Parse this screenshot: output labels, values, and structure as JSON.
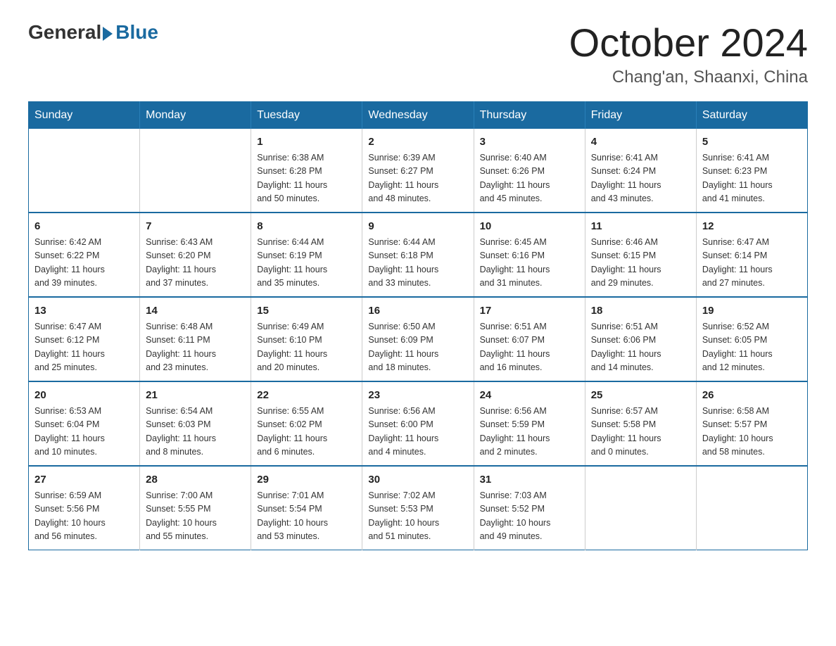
{
  "header": {
    "logo_general": "General",
    "logo_blue": "Blue",
    "title": "October 2024",
    "subtitle": "Chang'an, Shaanxi, China"
  },
  "calendar": {
    "days_of_week": [
      "Sunday",
      "Monday",
      "Tuesday",
      "Wednesday",
      "Thursday",
      "Friday",
      "Saturday"
    ],
    "weeks": [
      [
        {
          "day": "",
          "info": ""
        },
        {
          "day": "",
          "info": ""
        },
        {
          "day": "1",
          "info": "Sunrise: 6:38 AM\nSunset: 6:28 PM\nDaylight: 11 hours\nand 50 minutes."
        },
        {
          "day": "2",
          "info": "Sunrise: 6:39 AM\nSunset: 6:27 PM\nDaylight: 11 hours\nand 48 minutes."
        },
        {
          "day": "3",
          "info": "Sunrise: 6:40 AM\nSunset: 6:26 PM\nDaylight: 11 hours\nand 45 minutes."
        },
        {
          "day": "4",
          "info": "Sunrise: 6:41 AM\nSunset: 6:24 PM\nDaylight: 11 hours\nand 43 minutes."
        },
        {
          "day": "5",
          "info": "Sunrise: 6:41 AM\nSunset: 6:23 PM\nDaylight: 11 hours\nand 41 minutes."
        }
      ],
      [
        {
          "day": "6",
          "info": "Sunrise: 6:42 AM\nSunset: 6:22 PM\nDaylight: 11 hours\nand 39 minutes."
        },
        {
          "day": "7",
          "info": "Sunrise: 6:43 AM\nSunset: 6:20 PM\nDaylight: 11 hours\nand 37 minutes."
        },
        {
          "day": "8",
          "info": "Sunrise: 6:44 AM\nSunset: 6:19 PM\nDaylight: 11 hours\nand 35 minutes."
        },
        {
          "day": "9",
          "info": "Sunrise: 6:44 AM\nSunset: 6:18 PM\nDaylight: 11 hours\nand 33 minutes."
        },
        {
          "day": "10",
          "info": "Sunrise: 6:45 AM\nSunset: 6:16 PM\nDaylight: 11 hours\nand 31 minutes."
        },
        {
          "day": "11",
          "info": "Sunrise: 6:46 AM\nSunset: 6:15 PM\nDaylight: 11 hours\nand 29 minutes."
        },
        {
          "day": "12",
          "info": "Sunrise: 6:47 AM\nSunset: 6:14 PM\nDaylight: 11 hours\nand 27 minutes."
        }
      ],
      [
        {
          "day": "13",
          "info": "Sunrise: 6:47 AM\nSunset: 6:12 PM\nDaylight: 11 hours\nand 25 minutes."
        },
        {
          "day": "14",
          "info": "Sunrise: 6:48 AM\nSunset: 6:11 PM\nDaylight: 11 hours\nand 23 minutes."
        },
        {
          "day": "15",
          "info": "Sunrise: 6:49 AM\nSunset: 6:10 PM\nDaylight: 11 hours\nand 20 minutes."
        },
        {
          "day": "16",
          "info": "Sunrise: 6:50 AM\nSunset: 6:09 PM\nDaylight: 11 hours\nand 18 minutes."
        },
        {
          "day": "17",
          "info": "Sunrise: 6:51 AM\nSunset: 6:07 PM\nDaylight: 11 hours\nand 16 minutes."
        },
        {
          "day": "18",
          "info": "Sunrise: 6:51 AM\nSunset: 6:06 PM\nDaylight: 11 hours\nand 14 minutes."
        },
        {
          "day": "19",
          "info": "Sunrise: 6:52 AM\nSunset: 6:05 PM\nDaylight: 11 hours\nand 12 minutes."
        }
      ],
      [
        {
          "day": "20",
          "info": "Sunrise: 6:53 AM\nSunset: 6:04 PM\nDaylight: 11 hours\nand 10 minutes."
        },
        {
          "day": "21",
          "info": "Sunrise: 6:54 AM\nSunset: 6:03 PM\nDaylight: 11 hours\nand 8 minutes."
        },
        {
          "day": "22",
          "info": "Sunrise: 6:55 AM\nSunset: 6:02 PM\nDaylight: 11 hours\nand 6 minutes."
        },
        {
          "day": "23",
          "info": "Sunrise: 6:56 AM\nSunset: 6:00 PM\nDaylight: 11 hours\nand 4 minutes."
        },
        {
          "day": "24",
          "info": "Sunrise: 6:56 AM\nSunset: 5:59 PM\nDaylight: 11 hours\nand 2 minutes."
        },
        {
          "day": "25",
          "info": "Sunrise: 6:57 AM\nSunset: 5:58 PM\nDaylight: 11 hours\nand 0 minutes."
        },
        {
          "day": "26",
          "info": "Sunrise: 6:58 AM\nSunset: 5:57 PM\nDaylight: 10 hours\nand 58 minutes."
        }
      ],
      [
        {
          "day": "27",
          "info": "Sunrise: 6:59 AM\nSunset: 5:56 PM\nDaylight: 10 hours\nand 56 minutes."
        },
        {
          "day": "28",
          "info": "Sunrise: 7:00 AM\nSunset: 5:55 PM\nDaylight: 10 hours\nand 55 minutes."
        },
        {
          "day": "29",
          "info": "Sunrise: 7:01 AM\nSunset: 5:54 PM\nDaylight: 10 hours\nand 53 minutes."
        },
        {
          "day": "30",
          "info": "Sunrise: 7:02 AM\nSunset: 5:53 PM\nDaylight: 10 hours\nand 51 minutes."
        },
        {
          "day": "31",
          "info": "Sunrise: 7:03 AM\nSunset: 5:52 PM\nDaylight: 10 hours\nand 49 minutes."
        },
        {
          "day": "",
          "info": ""
        },
        {
          "day": "",
          "info": ""
        }
      ]
    ]
  }
}
